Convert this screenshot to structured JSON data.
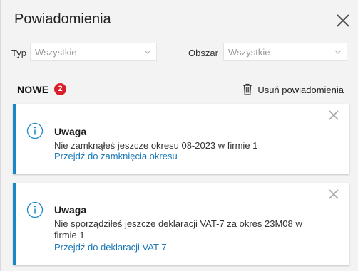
{
  "panel": {
    "title": "Powiadomienia"
  },
  "filters": {
    "type_label": "Typ",
    "type_value": "Wszystkie",
    "area_label": "Obszar",
    "area_value": "Wszystkie"
  },
  "new_section": {
    "label": "NOWE",
    "count": "2",
    "delete_all_label": "Usuń powiadomienia"
  },
  "notifications": [
    {
      "title": "Uwaga",
      "message": "Nie zamknąłeś jeszcze okresu 08-2023 w firmie 1",
      "link": "Przejdź do zamknięcia okresu"
    },
    {
      "title": "Uwaga",
      "message": "Nie sporządziłeś jeszcze deklaracji VAT-7 za okres 23M08 w firmie 1",
      "link": "Przejdź do deklaracji VAT-7"
    }
  ],
  "colors": {
    "accent": "#1a86c8",
    "link": "#1a78b8",
    "badge": "#d9202a"
  },
  "icons": {
    "close": "close-icon",
    "chevron": "chevron-down-icon",
    "trash": "trash-icon",
    "info": "info-icon"
  }
}
